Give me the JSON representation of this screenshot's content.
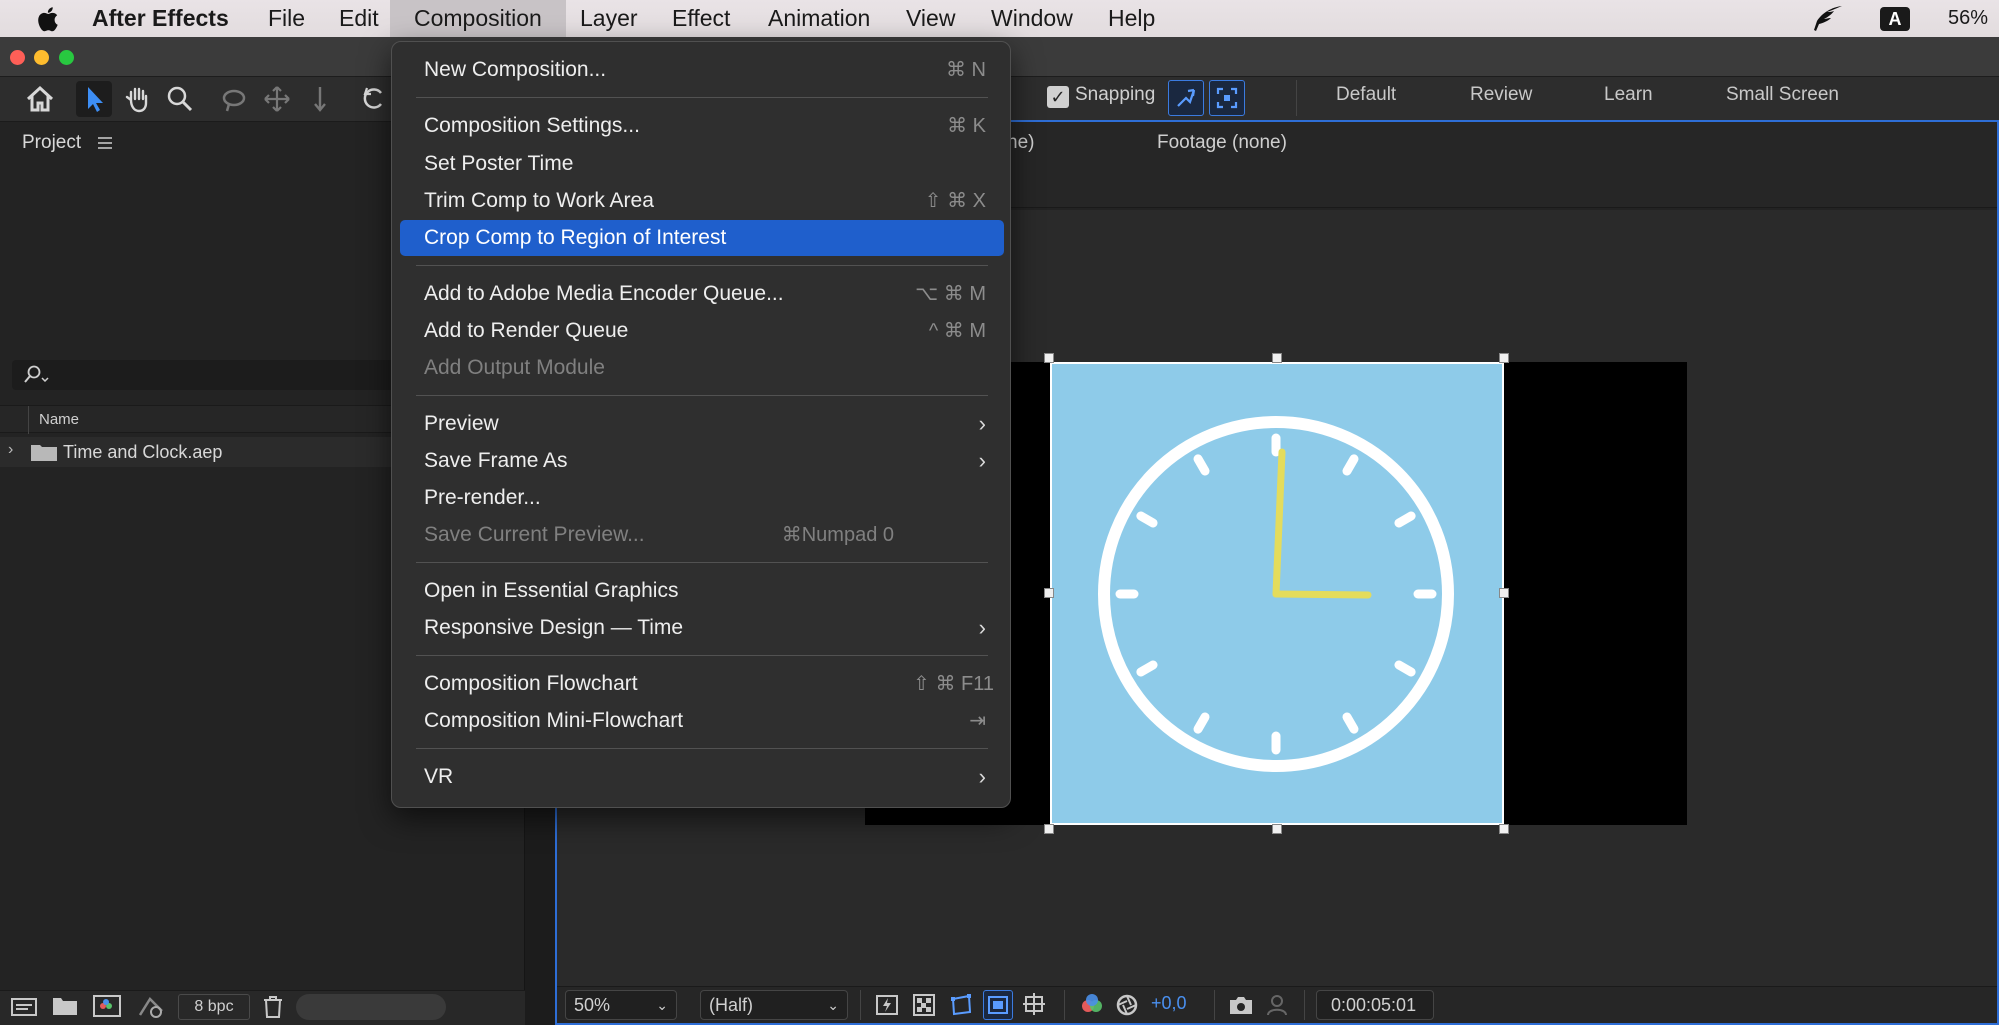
{
  "menubar": {
    "app_name": "After Effects",
    "items": [
      "File",
      "Edit",
      "Composition",
      "Layer",
      "Effect",
      "Animation",
      "View",
      "Window",
      "Help"
    ],
    "active_item": "Composition",
    "input_source": "A",
    "battery": "56%"
  },
  "toolbar": {
    "snapping_label": "Snapping",
    "snapping_checked": true,
    "workspaces": [
      "Default",
      "Review",
      "Learn",
      "Small Screen"
    ]
  },
  "project": {
    "title": "Project",
    "name_column": "Name",
    "item": "Time and Clock.aep",
    "bpc": "8 bpc"
  },
  "viewer": {
    "tab_partial": "ne)",
    "footage_tab": "Footage (none)",
    "zoom": "50%",
    "resolution": "(Half)",
    "exposure": "+0,0",
    "timecode": "0:00:05:01"
  },
  "composition_menu": {
    "items": [
      {
        "label": "New Composition...",
        "shortcut": "⌘ N",
        "state": "normal"
      },
      {
        "label": "Composition Settings...",
        "shortcut": "⌘ K",
        "state": "normal"
      },
      {
        "label": "Set Poster Time",
        "shortcut": "",
        "state": "normal"
      },
      {
        "label": "Trim Comp to Work Area",
        "shortcut": "⇧ ⌘ X",
        "state": "normal"
      },
      {
        "label": "Crop Comp to Region of Interest",
        "shortcut": "",
        "state": "highlighted"
      },
      {
        "label": "Add to Adobe Media Encoder Queue...",
        "shortcut": "⌥ ⌘ M",
        "state": "normal"
      },
      {
        "label": "Add to Render Queue",
        "shortcut": "^ ⌘ M",
        "state": "normal"
      },
      {
        "label": "Add Output Module",
        "shortcut": "",
        "state": "disabled"
      },
      {
        "label": "Preview",
        "shortcut": "",
        "state": "submenu"
      },
      {
        "label": "Save Frame As",
        "shortcut": "",
        "state": "submenu"
      },
      {
        "label": "Pre-render...",
        "shortcut": "",
        "state": "normal"
      },
      {
        "label": "Save Current Preview...",
        "shortcut": "⌘Numpad 0",
        "state": "disabled"
      },
      {
        "label": "Open in Essential Graphics",
        "shortcut": "",
        "state": "normal"
      },
      {
        "label": "Responsive Design — Time",
        "shortcut": "",
        "state": "submenu"
      },
      {
        "label": "Composition Flowchart",
        "shortcut": "⇧ ⌘ F11",
        "state": "normal"
      },
      {
        "label": "Composition Mini-Flowchart",
        "shortcut": "⇥",
        "state": "normal"
      },
      {
        "label": "VR",
        "shortcut": "",
        "state": "submenu"
      }
    ]
  },
  "colors": {
    "highlight": "#1f5fcc",
    "clock_background": "#8ecbe9",
    "clock_hands": "#e4dc5c",
    "clock_face": "#ffffff"
  }
}
